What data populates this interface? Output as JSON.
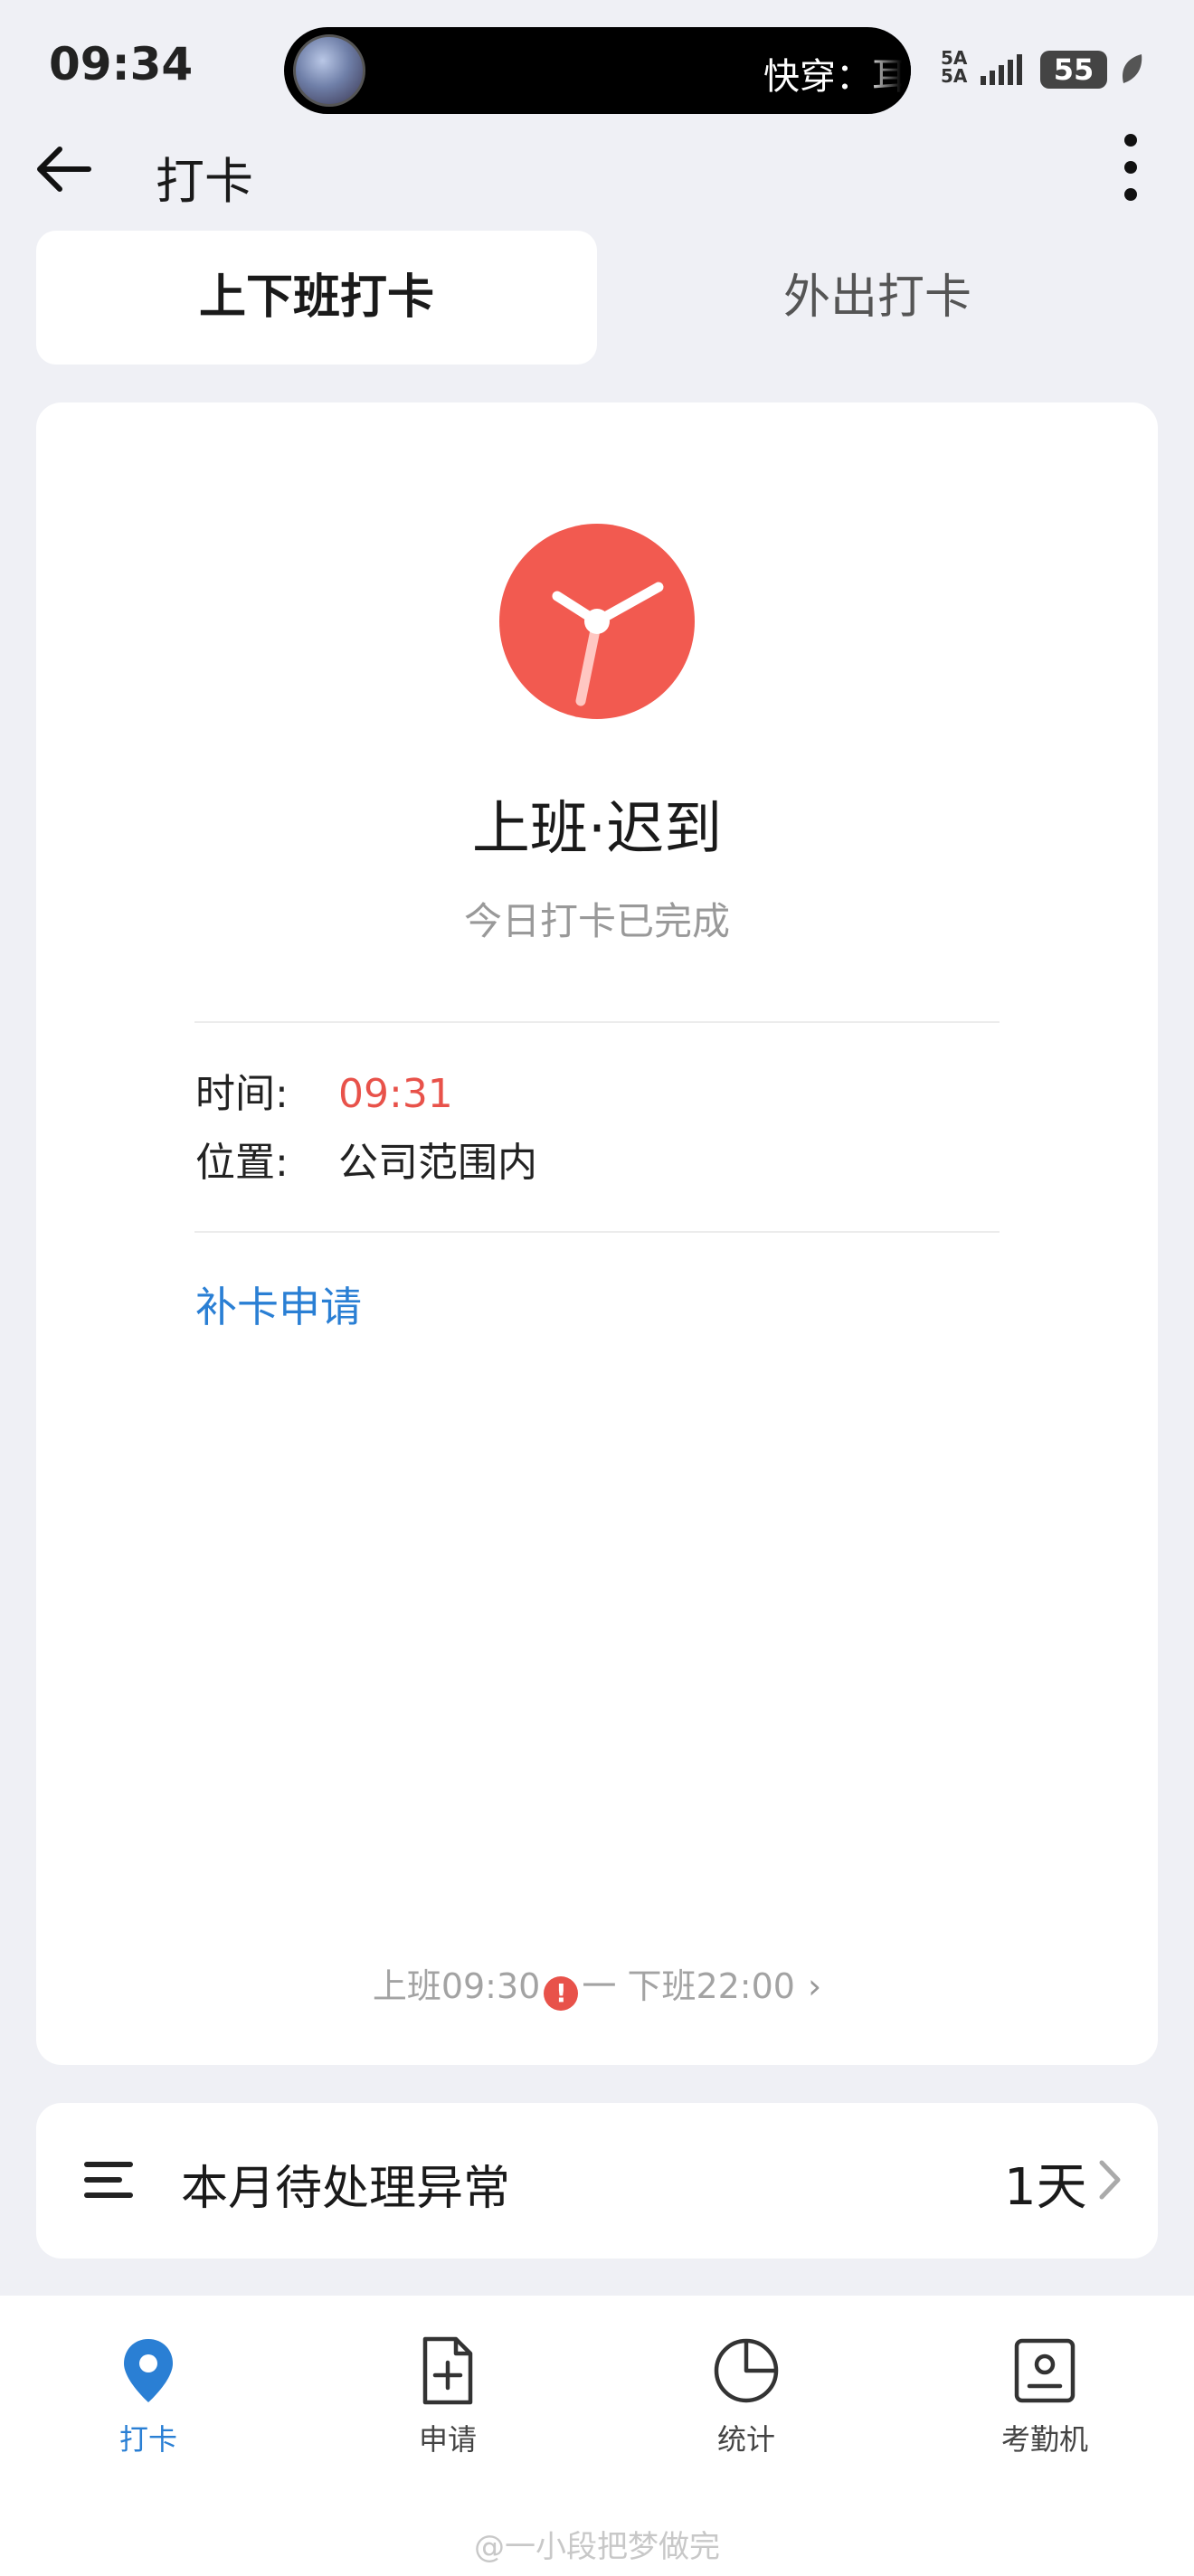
{
  "status_bar": {
    "time": "09:34",
    "island_text": "快穿：耳",
    "network": "5A",
    "network2": "5A",
    "battery": "55"
  },
  "app_bar": {
    "title": "打卡"
  },
  "tabs": [
    {
      "label": "上下班打卡",
      "active": true
    },
    {
      "label": "外出打卡",
      "active": false
    }
  ],
  "punch_card": {
    "status_title": "上班·迟到",
    "status_sub": "今日打卡已完成",
    "time_label": "时间:",
    "time_value": "09:31",
    "location_label": "位置:",
    "location_value": "公司范围内",
    "make_up_link": "补卡申请",
    "shift_start": "上班09:30",
    "shift_sep": "一",
    "shift_end": "下班22:00",
    "accent": "#e8524a"
  },
  "exceptions": {
    "label": "本月待处理异常",
    "count": "1天"
  },
  "bottom_nav": [
    {
      "label": "打卡",
      "icon": "location-pin-icon",
      "active": true
    },
    {
      "label": "申请",
      "icon": "document-add-icon",
      "active": false
    },
    {
      "label": "统计",
      "icon": "pie-chart-icon",
      "active": false
    },
    {
      "label": "考勤机",
      "icon": "attendance-machine-icon",
      "active": false
    }
  ],
  "watermark": "@一小段把梦做完",
  "colors": {
    "link": "#2a7fd4",
    "background": "#eff0f5"
  }
}
